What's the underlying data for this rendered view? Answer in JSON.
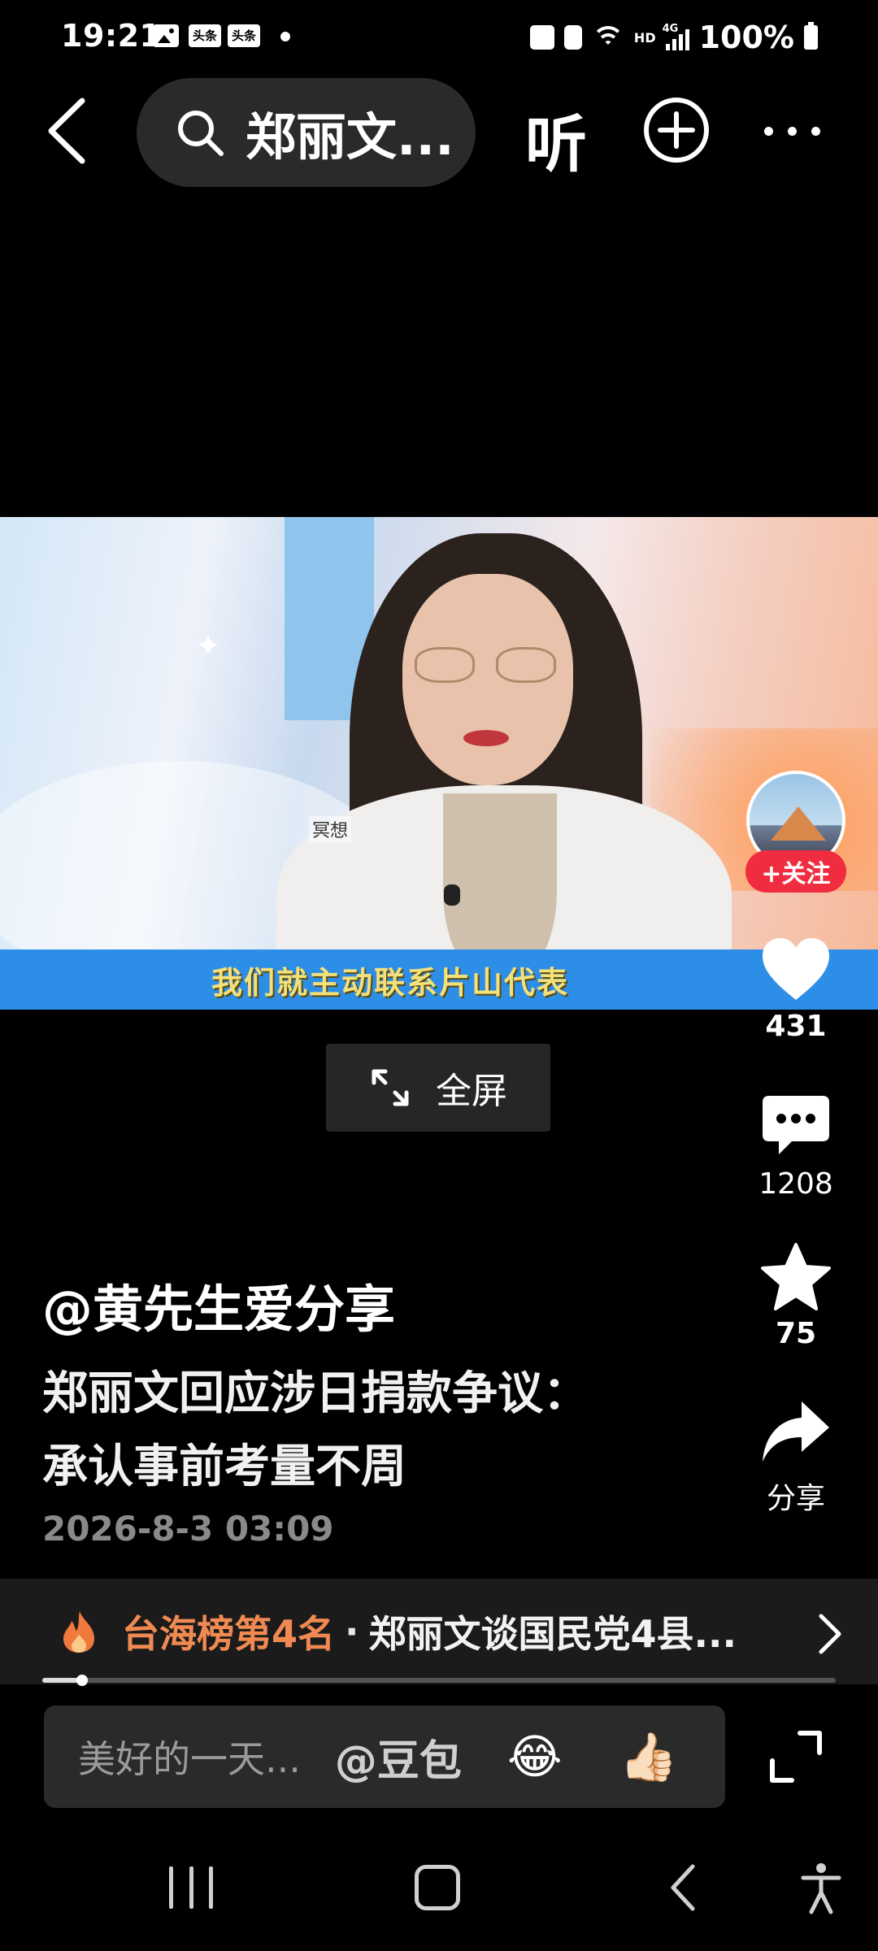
{
  "status_bar": {
    "time": "19:21",
    "notif_app_1": "头条",
    "notif_app_2": "头条",
    "network_4g": "4G",
    "hd": "HD",
    "battery": "100%"
  },
  "top_nav": {
    "search_text": "郑丽文...",
    "listen_label": "听"
  },
  "video": {
    "subtitle": "我们就主动联系片山代表",
    "small_label": "冥想",
    "fullscreen_label": "全屏"
  },
  "rail": {
    "follow_label": "+关注",
    "likes": "431",
    "comments": "1208",
    "favorites": "75",
    "share_label": "分享"
  },
  "post": {
    "author": "@黄先生爱分享",
    "title_line1": "郑丽文回应涉日捐款争议：",
    "title_line2": "承认事前考量不周",
    "date": "2026-8-3 03:09"
  },
  "hot": {
    "rank": "台海榜第4名",
    "separator": "·",
    "text": "郑丽文谈国民党4县..."
  },
  "progress": {
    "fraction": 0.05
  },
  "comment_bar": {
    "placeholder": "美好的一天...",
    "mention": "@豆包",
    "emoji_1": "😂",
    "emoji_2": "👍🏻"
  },
  "colors": {
    "follow_red": "#f02d40",
    "hot_orange": "#f08a52",
    "subtitle_yellow": "#f1e07b",
    "subtitle_band_blue": "#2d8ee7"
  }
}
